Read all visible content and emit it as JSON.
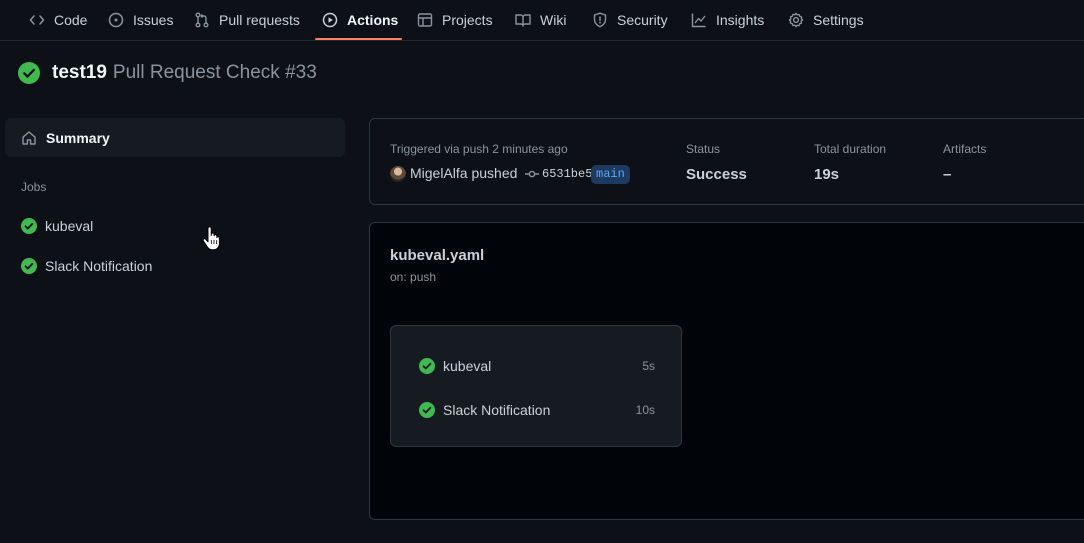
{
  "nav": {
    "tabs": [
      {
        "label": "Code",
        "icon": "code-icon"
      },
      {
        "label": "Issues",
        "icon": "issue-icon"
      },
      {
        "label": "Pull requests",
        "icon": "pull-request-icon"
      },
      {
        "label": "Actions",
        "icon": "play-icon",
        "active": true
      },
      {
        "label": "Projects",
        "icon": "table-icon"
      },
      {
        "label": "Wiki",
        "icon": "book-icon"
      },
      {
        "label": "Security",
        "icon": "shield-icon"
      },
      {
        "label": "Insights",
        "icon": "graph-icon"
      },
      {
        "label": "Settings",
        "icon": "gear-icon"
      }
    ]
  },
  "run": {
    "workflow": "test19",
    "title": "Pull Request Check #33"
  },
  "sidebar": {
    "summary_label": "Summary",
    "jobs_heading": "Jobs",
    "jobs": [
      {
        "label": "kubeval"
      },
      {
        "label": "Slack Notification"
      }
    ]
  },
  "status": {
    "trigger_text": "Triggered via push 2 minutes ago",
    "actor": "MigelAlfa pushed",
    "commit": "6531be5",
    "branch": "main",
    "status_label": "Status",
    "status_value": "Success",
    "duration_label": "Total duration",
    "duration_value": "19s",
    "artifacts_label": "Artifacts",
    "artifacts_value": "–"
  },
  "workflow": {
    "file": "kubeval.yaml",
    "trigger": "on: push",
    "jobs": [
      {
        "name": "kubeval",
        "duration": "5s"
      },
      {
        "name": "Slack Notification",
        "duration": "10s"
      }
    ]
  },
  "colors": {
    "background": "#0d1117",
    "success": "#3fb950",
    "accent_underline": "#f78166",
    "branch_bg": "#1f3a5f",
    "branch_fg": "#58a6ff"
  }
}
